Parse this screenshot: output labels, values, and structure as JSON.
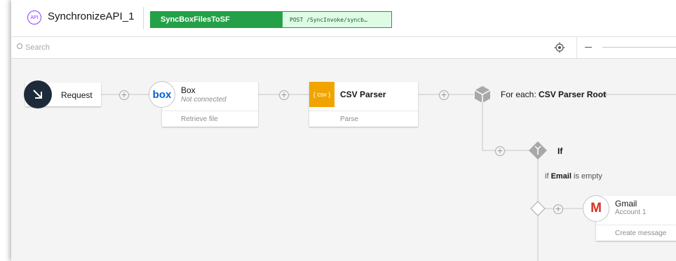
{
  "header": {
    "api_badge": "API",
    "flow_name": "SynchronizeAPI_1",
    "tab_name": "SyncBoxFilesToSF",
    "tab_endpoint": "POST /SyncInvoke/syncb…"
  },
  "toolbar": {
    "search_placeholder": "Search",
    "zoom_out": "−"
  },
  "nodes": {
    "request": {
      "title": "Request",
      "icon": "arrow-down-right-icon"
    },
    "box": {
      "logo": "box",
      "title": "Box",
      "subtitle": "Not connected",
      "action": "Retrieve file",
      "color": "#0061d5"
    },
    "csv": {
      "logo": "{ csv }",
      "title": "CSV Parser",
      "action": "Parse",
      "color": "#f1a400"
    },
    "foreach": {
      "prefix": "For each: ",
      "target": "CSV Parser Root",
      "icon": "cube-icon"
    },
    "if": {
      "title": "If",
      "icon": "branch-icon"
    },
    "condition": {
      "prefix": "if ",
      "field": "Email",
      "suffix": " is empty"
    },
    "gmail": {
      "logo": "M",
      "title": "Gmail",
      "subtitle": "Account 1",
      "action": "Create message",
      "color": "#d93025"
    }
  },
  "connector_plus": "+"
}
